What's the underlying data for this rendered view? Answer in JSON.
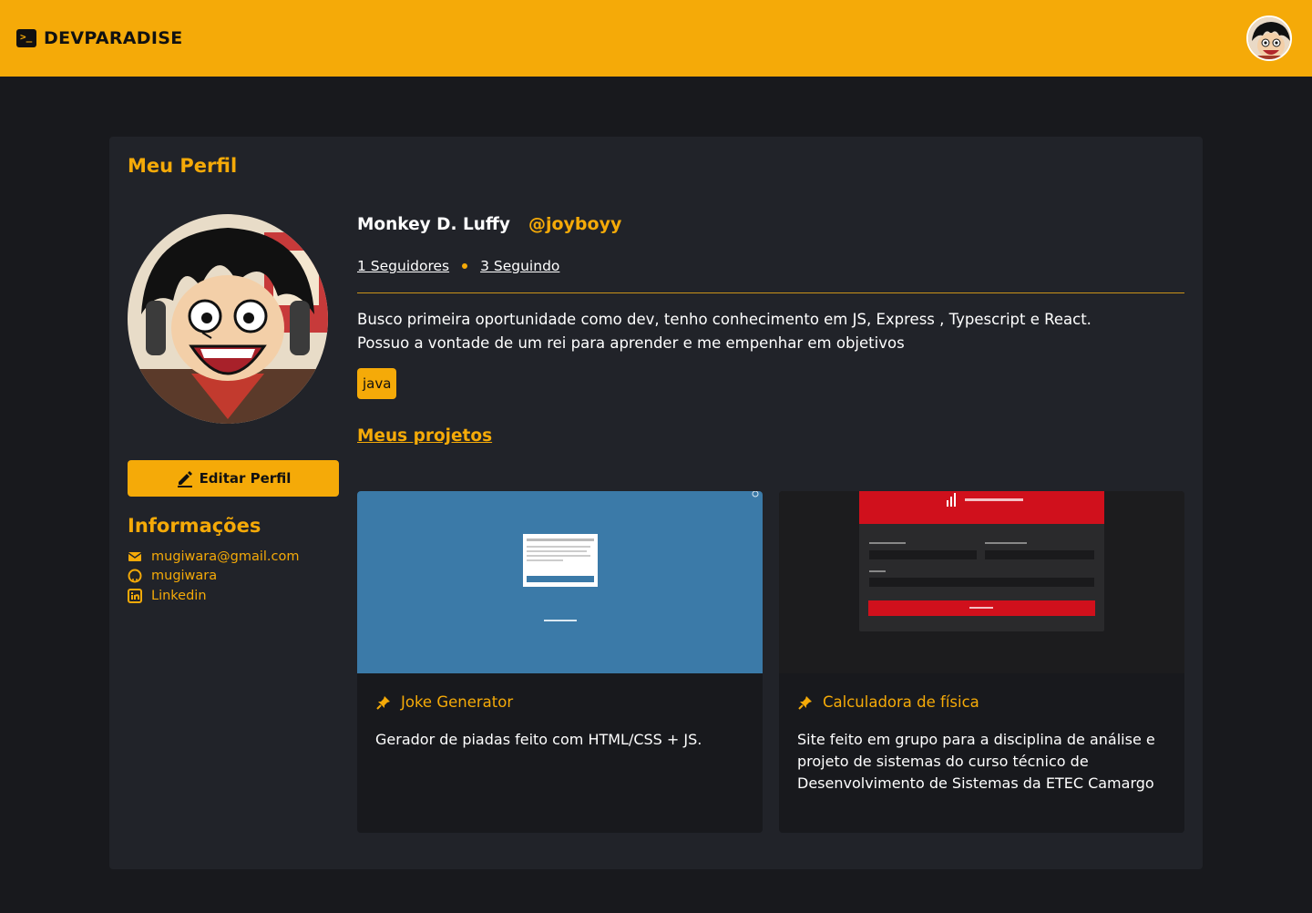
{
  "header": {
    "brand": "DEVPARADISE",
    "brand_glyph": ">_"
  },
  "profile": {
    "section_title": "Meu Perfil",
    "name": "Monkey D. Luffy",
    "handle": "@joyboyy",
    "followers": "1 Seguidores",
    "following": "3 Seguindo",
    "bio_line1": "Busco primeira oportunidade como dev, tenho conhecimento em JS, Express , Typescript e React.",
    "bio_line2": "Possuo a vontade de um rei para aprender e me empenhar em objetivos",
    "tag": "java",
    "edit_button": "Editar Perfil"
  },
  "info": {
    "title": "Informações",
    "email": "mugiwara@gmail.com",
    "github": "mugiwara",
    "linkedin": "Linkedin"
  },
  "projects": {
    "title": "Meus projetos",
    "items": [
      {
        "name": "Joke Generator",
        "desc": "Gerador de piadas feito com HTML/CSS + JS."
      },
      {
        "name": "Calculadora de física",
        "desc": "Site feito em grupo para a disciplina de análise e projeto de sistemas do curso técnico de Desenvolvimento de Sistemas da ETEC Camargo"
      }
    ]
  },
  "colors": {
    "accent": "#f5aa08",
    "background": "#18191d",
    "card": "#212329"
  }
}
